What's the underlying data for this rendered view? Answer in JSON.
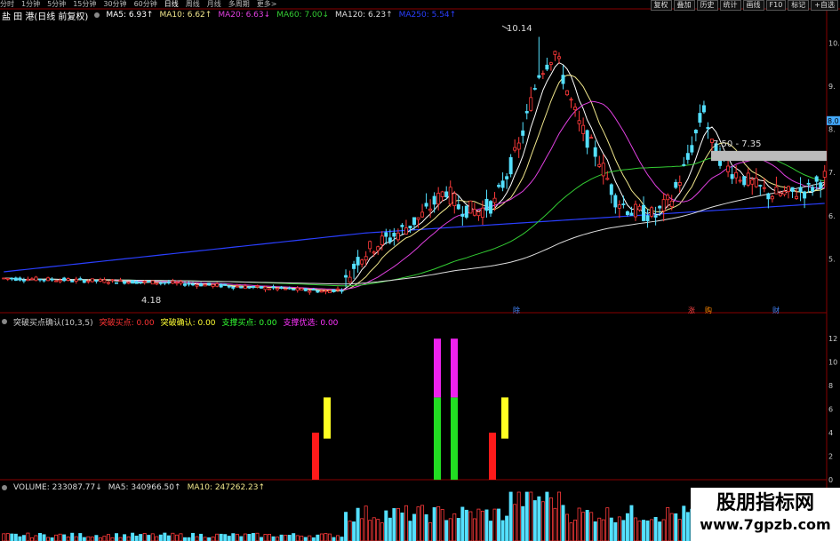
{
  "toolbar": {
    "period_tabs": [
      "分时",
      "1分钟",
      "5分钟",
      "15分钟",
      "30分钟",
      "60分钟",
      "日线",
      "周线",
      "月线",
      "多周期",
      "更多>"
    ],
    "active_tab": 6,
    "right_buttons": [
      "复权",
      "叠加",
      "历史",
      "统计",
      "画线",
      "F10",
      "标记",
      "+自选"
    ]
  },
  "main_panel": {
    "stock_title": "盐 田 港(日线 前复权)",
    "ma_labels": [
      {
        "text": "MA5: 6.93",
        "arrow": "↑",
        "color": "#ffffff"
      },
      {
        "text": "MA10: 6.62",
        "arrow": "↑",
        "color": "#f0e68c"
      },
      {
        "text": "MA20: 6.63",
        "arrow": "↓",
        "color": "#e040e0"
      },
      {
        "text": "MA60: 7.00",
        "arrow": "↓",
        "color": "#33cc33"
      },
      {
        "text": "MA120: 6.23",
        "arrow": "↑",
        "color": "#dddddd"
      },
      {
        "text": "MA250: 5.54",
        "arrow": "↑",
        "color": "#2a3fff"
      }
    ],
    "high_label": "10.14",
    "low_label": "4.18",
    "zone_label": "7.50 - 7.35",
    "event_tags": [
      {
        "text": "除",
        "color": "#4488ff"
      },
      {
        "text": "涨",
        "color": "#ff4444"
      },
      {
        "text": "购",
        "color": "#ff8800"
      },
      {
        "text": "财",
        "color": "#4488ff"
      }
    ],
    "axis_fragments": [
      "10.",
      "9.",
      "8.",
      "8.0",
      "7.",
      "6.",
      "5."
    ]
  },
  "indicator_panel": {
    "name": "突破买点确认(10,3,5)",
    "items": [
      {
        "text": "突破买点: 0.00",
        "color": "#ff3333"
      },
      {
        "text": "突破确认: 0.00",
        "color": "#ffff33"
      },
      {
        "text": "支撑买点: 0.00",
        "color": "#33ff33"
      },
      {
        "text": "支撑优选: 0.00",
        "color": "#ff33ff"
      }
    ],
    "axis_fragments": [
      "12",
      "10",
      "8",
      "6",
      "4",
      "2",
      "0"
    ]
  },
  "volume_panel": {
    "items": [
      {
        "text": "VOLUME: 233087.77",
        "arrow": "↓",
        "color": "#dddddd"
      },
      {
        "text": "MA5: 340966.50",
        "arrow": "↑",
        "color": "#dddddd"
      },
      {
        "text": "MA10: 247262.23",
        "arrow": "↑",
        "color": "#f0e68c"
      }
    ]
  },
  "watermark": {
    "line1": "股朋指标网",
    "line2": "www.7gpzb.com"
  },
  "chart_data": {
    "type": "candlestick",
    "title": "盐 田 港(日线 前复权)",
    "price_range": [
      4.0,
      10.5
    ],
    "high": 10.14,
    "low": 4.18,
    "ma_current": {
      "MA5": 6.93,
      "MA10": 6.62,
      "MA20": 6.63,
      "MA60": 7.0,
      "MA120": 6.23,
      "MA250": 5.54
    },
    "indicator_signals": [
      {
        "bar": 60,
        "series": "突破买点",
        "value": 4
      },
      {
        "bar": 63,
        "series": "突破确认",
        "value": 7
      },
      {
        "bar": 84,
        "series": "支撑买点",
        "value": 7
      },
      {
        "bar": 84,
        "series": "支撑优选",
        "value": 12
      },
      {
        "bar": 87,
        "series": "支撑买点",
        "value": 7
      },
      {
        "bar": 87,
        "series": "支撑优选",
        "value": 12
      },
      {
        "bar": 94,
        "series": "突破买点",
        "value": 4
      },
      {
        "bar": 97,
        "series": "突破确认",
        "value": 7
      }
    ],
    "indicator_range": [
      0,
      13
    ],
    "volume_ma": {
      "MA5": 340966.5,
      "MA10": 247262.23
    },
    "volume_last": 233087.77
  }
}
